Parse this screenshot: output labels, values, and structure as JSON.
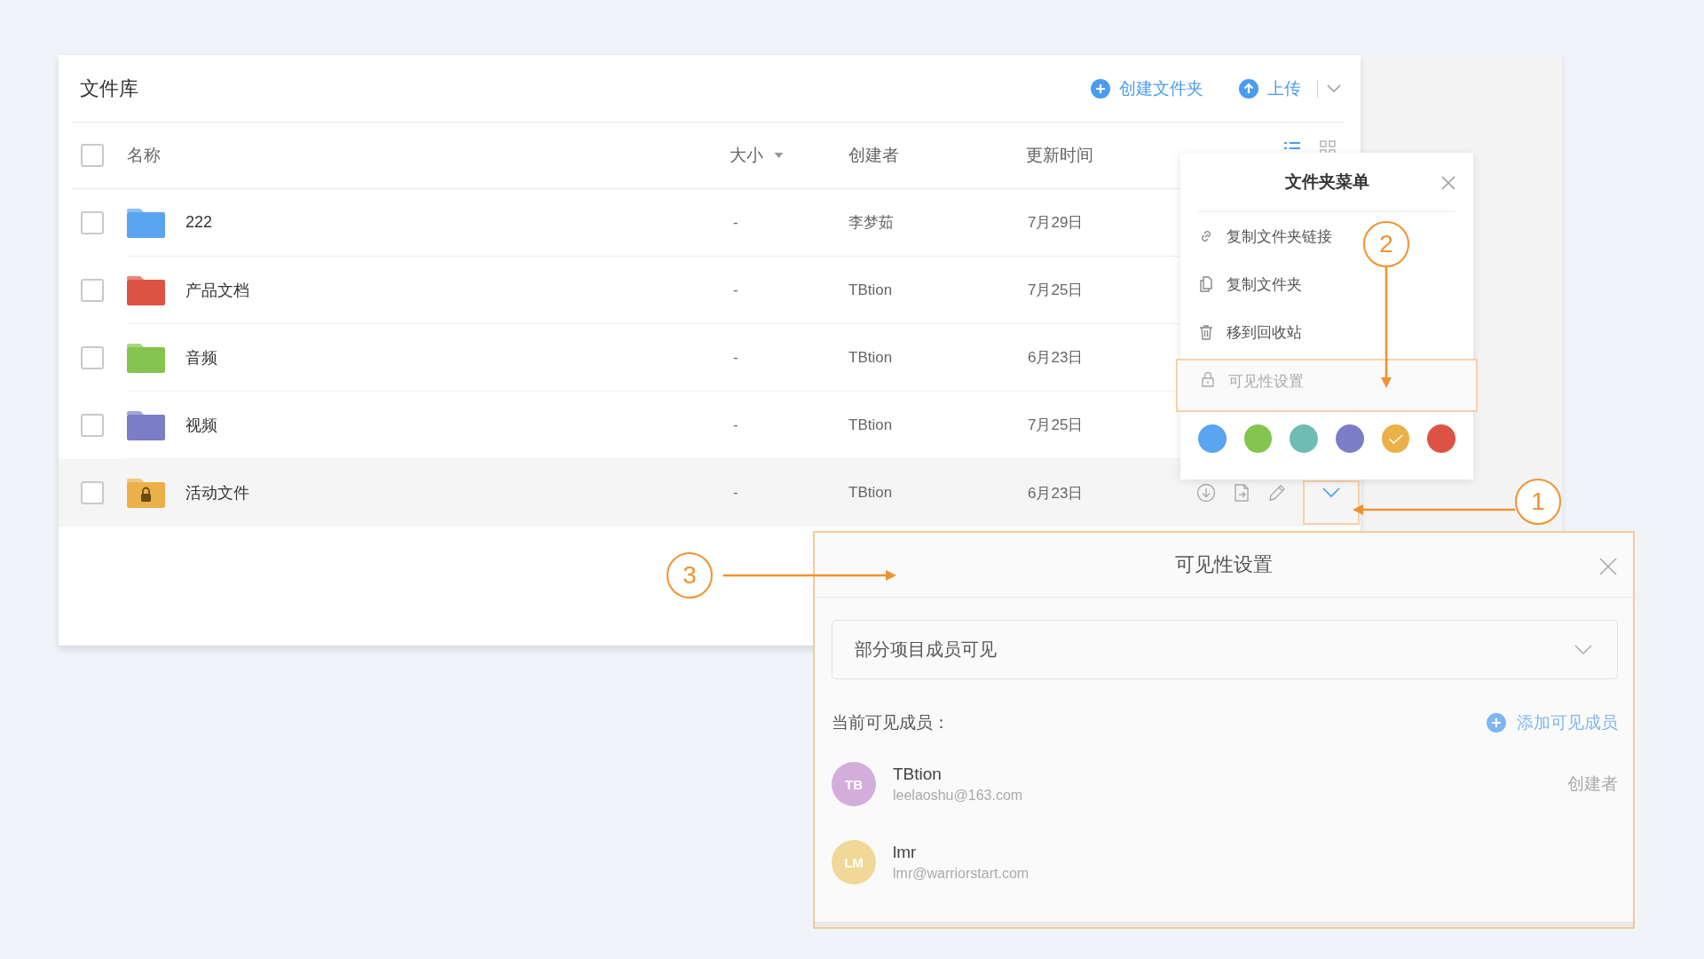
{
  "library": {
    "title": "文件库",
    "actions": [
      {
        "kind": "create",
        "label": "创建文件夹"
      },
      {
        "kind": "upload",
        "label": "上传"
      }
    ]
  },
  "table": {
    "all_checked": false,
    "columns": [
      {
        "label": "名称",
        "sortable": false
      },
      {
        "label": "大小",
        "sortable": true
      },
      {
        "label": "创建者",
        "sortable": false
      },
      {
        "label": "更新时间",
        "sortable": false
      }
    ],
    "view_modes": [
      {
        "kind": "list",
        "selected": true
      },
      {
        "kind": "grid",
        "selected": false
      }
    ],
    "rows": [
      {
        "name": "222",
        "color": "#5aa4f0",
        "locked": false,
        "checked": false,
        "selected": false,
        "size": "-",
        "creator": "李梦茹",
        "updated": "7月29日"
      },
      {
        "name": "产品文档",
        "color": "#dc5343",
        "locked": false,
        "checked": false,
        "selected": false,
        "size": "-",
        "creator": "TBtion",
        "updated": "7月25日"
      },
      {
        "name": "音频",
        "color": "#83c54f",
        "locked": false,
        "checked": false,
        "selected": false,
        "size": "-",
        "creator": "TBtion",
        "updated": "6月23日"
      },
      {
        "name": "视频",
        "color": "#7b7ec6",
        "locked": false,
        "checked": false,
        "selected": false,
        "size": "-",
        "creator": "TBtion",
        "updated": "7月25日"
      },
      {
        "name": "活动文件",
        "color": "#ebb047",
        "locked": true,
        "checked": false,
        "selected": true,
        "size": "-",
        "creator": "TBtion",
        "updated": "6月23日"
      }
    ]
  },
  "folder_menu": {
    "title": "文件夹菜单",
    "items": [
      {
        "kind": "link",
        "label": "复制文件夹链接",
        "selected": false
      },
      {
        "kind": "copy",
        "label": "复制文件夹",
        "selected": false
      },
      {
        "kind": "trash",
        "label": "移到回收站",
        "selected": false
      },
      {
        "kind": "lock",
        "label": "可见性设置",
        "selected": true
      }
    ],
    "colors": [
      {
        "color": "#5aa4f0",
        "selected": false
      },
      {
        "color": "#83c54f",
        "selected": false
      },
      {
        "color": "#6fbcb4",
        "selected": false
      },
      {
        "color": "#7b7ec6",
        "selected": false
      },
      {
        "color": "#ebb047",
        "selected": true
      },
      {
        "color": "#dc5343",
        "selected": false
      }
    ]
  },
  "visibility_dialog": {
    "title": "可见性设置",
    "scope": "部分项目成员可见",
    "members_label": "当前可见成员：",
    "add_member": "添加可见成员",
    "members": [
      {
        "initials": "TB",
        "name": "TBtion",
        "email": "leelaoshu@163.com",
        "role": "创建者",
        "color": "#d3aedb"
      },
      {
        "initials": "LM",
        "name": "lmr",
        "email": "lmr@warriorstart.com",
        "color": "#efd898"
      }
    ]
  },
  "annotations": [
    {
      "label": "1"
    },
    {
      "label": "2"
    },
    {
      "label": "3"
    }
  ]
}
